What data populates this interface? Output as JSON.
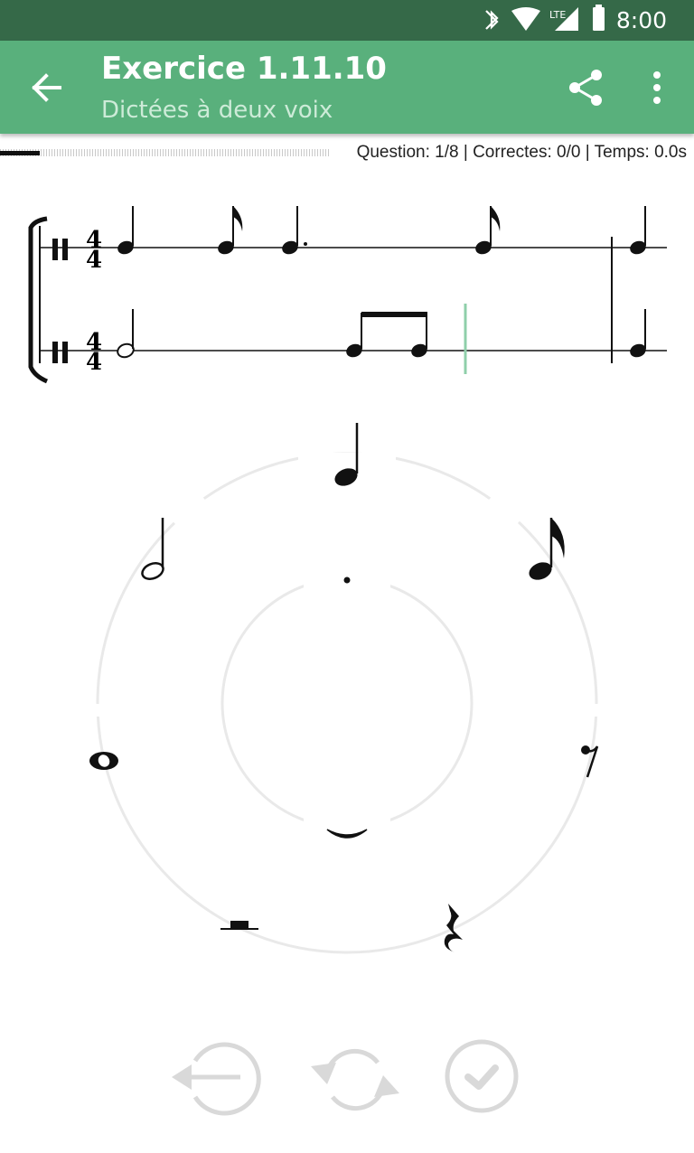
{
  "status_bar": {
    "time": "8:00",
    "icons": [
      "bluetooth-icon",
      "wifi-icon",
      "lte-signal-icon",
      "battery-icon"
    ],
    "network_label": "LTE"
  },
  "app_bar": {
    "title": "Exercice 1.11.10",
    "subtitle": "Dictées à deux voix",
    "actions": [
      "back-arrow-icon",
      "share-icon",
      "more-vert-icon"
    ]
  },
  "exercise": {
    "stats": "Question: 1/8 | Correctes: 0/0 | Temps: 0.0s",
    "progress_fraction": 0.12
  },
  "score": {
    "time_signature_top": "4",
    "time_signature_bottom": "4"
  },
  "note_picker": {
    "items": [
      "quarter-note",
      "eighth-note",
      "eighth-rest",
      "quarter-rest",
      "half-rest",
      "whole-note",
      "half-note",
      "dot",
      "tie"
    ]
  },
  "controls": [
    "undo-button",
    "restart-button",
    "validate-button"
  ],
  "colors": {
    "status_bar": "#356948",
    "app_bar": "#59b07c",
    "cursor": "#8fcfaa",
    "wheel": "#e9e9e9",
    "control": "#d9d9d9"
  }
}
